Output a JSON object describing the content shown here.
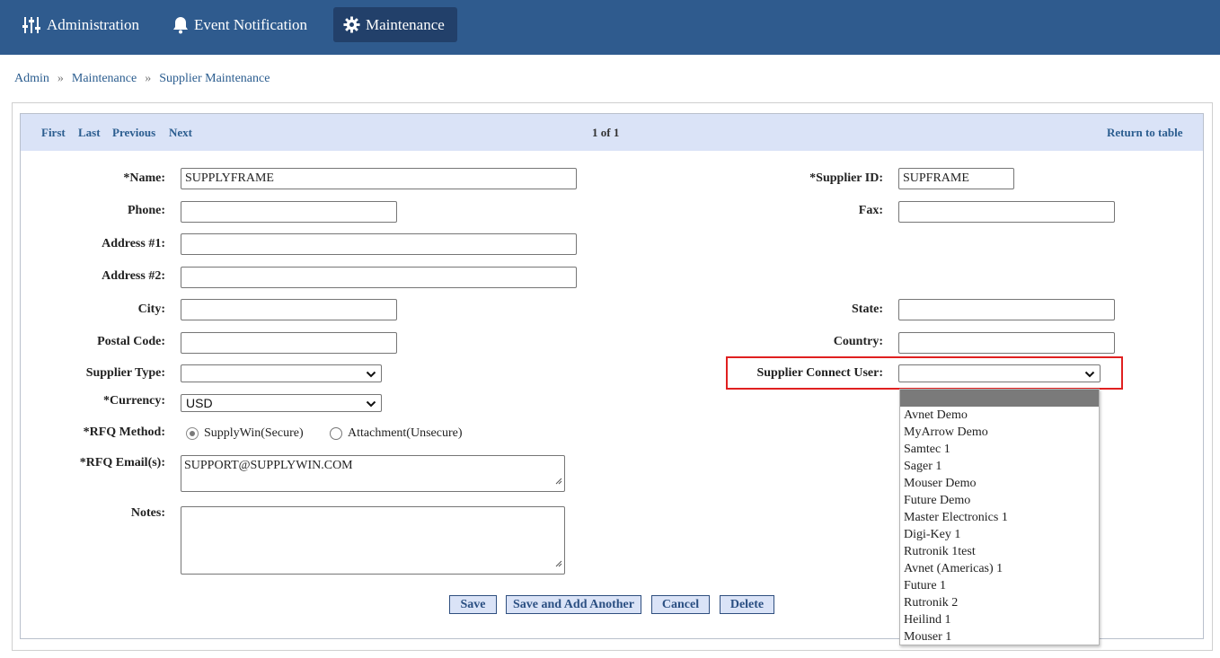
{
  "nav": {
    "items": [
      {
        "label": "Administration",
        "icon": "sliders-icon"
      },
      {
        "label": "Event Notification",
        "icon": "bell-icon"
      },
      {
        "label": "Maintenance",
        "icon": "gear-icon",
        "active": true
      }
    ]
  },
  "breadcrumb": {
    "items": [
      "Admin",
      "Maintenance",
      "Supplier Maintenance"
    ],
    "separator": "»"
  },
  "pager": {
    "first": "First",
    "last": "Last",
    "previous": "Previous",
    "next": "Next",
    "count": "1 of 1",
    "return": "Return to table"
  },
  "form": {
    "name": {
      "label": "*Name:",
      "value": "SUPPLYFRAME"
    },
    "supplier_id": {
      "label": "*Supplier ID:",
      "value": "SUPFRAME"
    },
    "phone": {
      "label": "Phone:",
      "value": ""
    },
    "fax": {
      "label": "Fax:",
      "value": ""
    },
    "address1": {
      "label": "Address #1:",
      "value": ""
    },
    "address2": {
      "label": "Address #2:",
      "value": ""
    },
    "city": {
      "label": "City:",
      "value": ""
    },
    "state": {
      "label": "State:",
      "value": ""
    },
    "postal": {
      "label": "Postal Code:",
      "value": ""
    },
    "country": {
      "label": "Country:",
      "value": ""
    },
    "supplier_type": {
      "label": "Supplier Type:",
      "value": ""
    },
    "connect_user": {
      "label": "Supplier Connect User:",
      "value": ""
    },
    "currency": {
      "label": "*Currency:",
      "value": "USD"
    },
    "rfq_method": {
      "label": "*RFQ Method:",
      "options": [
        "SupplyWin(Secure)",
        "Attachment(Unsecure)"
      ],
      "selected": "SupplyWin(Secure)"
    },
    "rfq_email": {
      "label": "*RFQ Email(s):",
      "value": "SUPPORT@SUPPLYWIN.COM"
    },
    "notes": {
      "label": "Notes:",
      "value": ""
    }
  },
  "buttons": {
    "save": "Save",
    "save_add": "Save and Add Another",
    "cancel": "Cancel",
    "delete": "Delete"
  },
  "connect_user_options": [
    "Avnet Demo",
    "MyArrow Demo",
    "Samtec 1",
    "Sager 1",
    "Mouser Demo",
    "Future Demo",
    "Master Electronics 1",
    "Digi-Key 1",
    "Rutronik 1test",
    "Avnet (Americas) 1",
    "Future 1",
    "Rutronik 2",
    "Heilind 1",
    "Mouser 1"
  ],
  "colors": {
    "nav_bg": "#2f5b8e",
    "nav_active": "#22406a",
    "link": "#2b5d8f",
    "pager_bg": "#dae3f7",
    "highlight": "#e02020"
  }
}
